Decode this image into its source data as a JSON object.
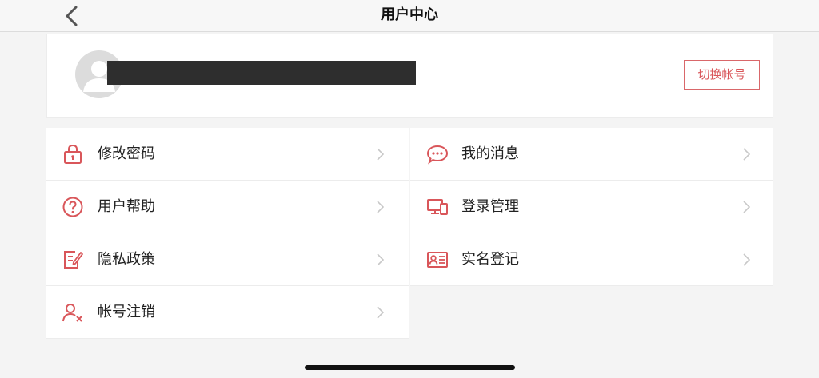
{
  "nav": {
    "title": "用户中心",
    "back_icon": "chevron-left-icon"
  },
  "profile": {
    "avatar_icon": "user-avatar-icon",
    "switch_account_label": "切换帐号"
  },
  "menu": {
    "items": [
      {
        "label": "修改密码",
        "icon": "lock-icon"
      },
      {
        "label": "我的消息",
        "icon": "chat-bubble-icon"
      },
      {
        "label": "用户帮助",
        "icon": "help-circle-icon"
      },
      {
        "label": "登录管理",
        "icon": "devices-icon"
      },
      {
        "label": "隐私政策",
        "icon": "policy-document-icon"
      },
      {
        "label": "实名登记",
        "icon": "id-card-icon"
      },
      {
        "label": "帐号注销",
        "icon": "user-remove-icon"
      }
    ]
  },
  "colors": {
    "accent": "#d9565a",
    "background": "#f4f4f4",
    "card": "#ffffff"
  }
}
